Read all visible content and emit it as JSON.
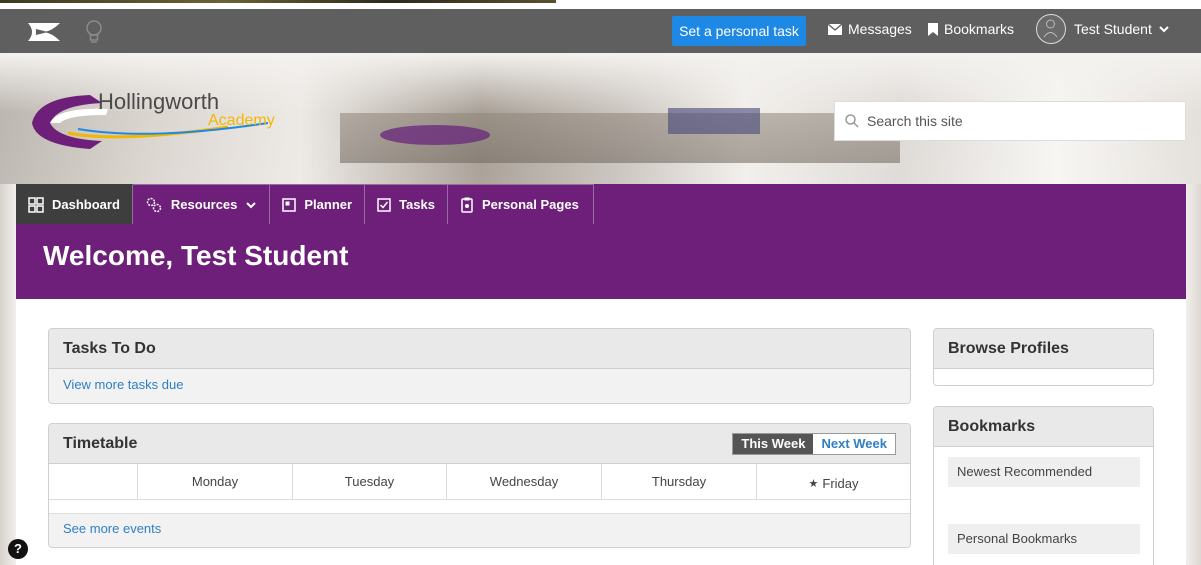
{
  "topbar": {
    "personal_task_label": "Set a personal task",
    "messages_label": "Messages",
    "bookmarks_label": "Bookmarks",
    "user_name": "Test Student",
    "colors": {
      "bar": "#5f5f5f",
      "primary_button": "#1e88e5"
    }
  },
  "brand": {
    "name_main": "Hollingworth",
    "name_sub": "Academy"
  },
  "search": {
    "placeholder": "Search this site"
  },
  "nav": {
    "items": [
      {
        "label": "Dashboard",
        "icon": "grid-icon",
        "active": true
      },
      {
        "label": "Resources",
        "icon": "cogs-icon",
        "dropdown": true
      },
      {
        "label": "Planner",
        "icon": "planner-icon"
      },
      {
        "label": "Tasks",
        "icon": "checkbox-icon"
      },
      {
        "label": "Personal Pages",
        "icon": "page-icon"
      }
    ],
    "colors": {
      "band": "#6d1f7a",
      "active": "#3e3e3e"
    }
  },
  "welcome": {
    "title": "Welcome, Test Student"
  },
  "tasks_panel": {
    "title": "Tasks To Do",
    "link": "View more tasks due"
  },
  "timetable": {
    "title": "Timetable",
    "this_week": "This Week",
    "next_week": "Next Week",
    "days": [
      "Monday",
      "Tuesday",
      "Wednesday",
      "Thursday",
      "Friday"
    ],
    "current_day_index": 4,
    "link": "See more events"
  },
  "browse_profiles": {
    "title": "Browse Profiles"
  },
  "bookmarks_panel": {
    "title": "Bookmarks",
    "items": [
      "Newest Recommended",
      "Personal Bookmarks"
    ]
  },
  "help": {
    "label": "?"
  }
}
